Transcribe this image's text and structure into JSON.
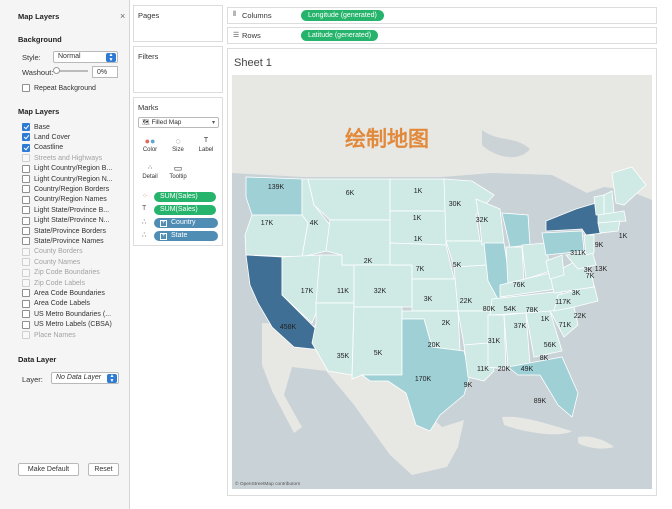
{
  "left_panel": {
    "title": "Map Layers",
    "close_glyph": "×",
    "background_heading": "Background",
    "style_label": "Style:",
    "style_value": "Normal",
    "washout_label": "Washout:",
    "washout_value": "0%",
    "washout_fraction": 0,
    "repeat_background": {
      "label": "Repeat Background",
      "checked": false
    },
    "map_layers_heading": "Map Layers",
    "layers": [
      {
        "label": "Base",
        "checked": true,
        "enabled": true
      },
      {
        "label": "Land Cover",
        "checked": true,
        "enabled": true
      },
      {
        "label": "Coastline",
        "checked": true,
        "enabled": true
      },
      {
        "label": "Streets and Highways",
        "checked": false,
        "enabled": false
      },
      {
        "label": "Light Country/Region B...",
        "checked": false,
        "enabled": true
      },
      {
        "label": "Light Country/Region N...",
        "checked": false,
        "enabled": true
      },
      {
        "label": "Country/Region Borders",
        "checked": false,
        "enabled": true
      },
      {
        "label": "Country/Region Names",
        "checked": false,
        "enabled": true
      },
      {
        "label": "Light State/Province B...",
        "checked": false,
        "enabled": true
      },
      {
        "label": "Light State/Province N...",
        "checked": false,
        "enabled": true
      },
      {
        "label": "State/Province Borders",
        "checked": false,
        "enabled": true
      },
      {
        "label": "State/Province Names",
        "checked": false,
        "enabled": true
      },
      {
        "label": "County Borders",
        "checked": false,
        "enabled": false
      },
      {
        "label": "County Names",
        "checked": false,
        "enabled": false
      },
      {
        "label": "Zip Code Boundaries",
        "checked": false,
        "enabled": false
      },
      {
        "label": "Zip Code Labels",
        "checked": false,
        "enabled": false
      },
      {
        "label": "Area Code Boundaries",
        "checked": false,
        "enabled": true
      },
      {
        "label": "Area Code Labels",
        "checked": false,
        "enabled": true
      },
      {
        "label": "US Metro Boundaries (...",
        "checked": false,
        "enabled": true
      },
      {
        "label": "US Metro Labels (CBSA)",
        "checked": false,
        "enabled": true
      },
      {
        "label": "Place Names",
        "checked": false,
        "enabled": false
      }
    ],
    "data_layer_heading": "Data Layer",
    "layer_label": "Layer:",
    "layer_value": "No Data Layer",
    "make_default_label": "Make Default",
    "reset_label": "Reset"
  },
  "cards": {
    "pages_title": "Pages",
    "filters_title": "Filters",
    "marks_title": "Marks",
    "mark_type": "Filled Map",
    "mark_type_icon": "filled-map-icon",
    "buttons": [
      {
        "label": "Color",
        "icon": "color-dots-icon"
      },
      {
        "label": "Size",
        "icon": "size-icon"
      },
      {
        "label": "Label",
        "icon": "label-icon"
      },
      {
        "label": "Detail",
        "icon": "detail-dots-icon"
      },
      {
        "label": "Tooltip",
        "icon": "tooltip-icon"
      }
    ],
    "mark_pills": [
      {
        "label": "SUM(Sales)",
        "kind": "measure",
        "icon": "color-dots-icon"
      },
      {
        "label": "SUM(Sales)",
        "kind": "measure",
        "icon": "label-icon"
      },
      {
        "label": "Country",
        "kind": "dimension",
        "icon": "detail-dots-icon"
      },
      {
        "label": "State",
        "kind": "dimension",
        "icon": "detail-dots-icon"
      }
    ]
  },
  "shelves": {
    "columns_label": "Columns",
    "columns_pill": "Longitude (generated)",
    "rows_label": "Rows",
    "rows_pill": "Latitude (generated)"
  },
  "sheet": {
    "title": "Sheet 1",
    "watermark": "绘制地图",
    "attribution": "© OpenStreetMap contributors",
    "sales_labels": [
      "139K",
      "17K",
      "6K",
      "4K",
      "1K",
      "1K",
      "1K",
      "30K",
      "32K",
      "2K",
      "7K",
      "5K",
      "11K",
      "17K",
      "32K",
      "3K",
      "22K",
      "80K",
      "54K",
      "78K",
      "76K",
      "311K",
      "9K",
      "1K",
      "3K",
      "13K",
      "458K",
      "117K",
      "7K",
      "37K",
      "1K",
      "71K",
      "22K",
      "35K",
      "5K",
      "20K",
      "31K",
      "56K",
      "8K",
      "170K",
      "11K",
      "20K",
      "49K",
      "9K",
      "89K",
      "3K",
      "2K"
    ]
  },
  "colors": {
    "accent_blue": "#2e7bd6",
    "pill_green": "#26b36b",
    "pill_blue": "#4f8db4",
    "map_light": "#cfe9e5",
    "map_mid": "#9fd0d6",
    "map_dark": "#3f6f94",
    "watermark": "#e28a3c"
  }
}
